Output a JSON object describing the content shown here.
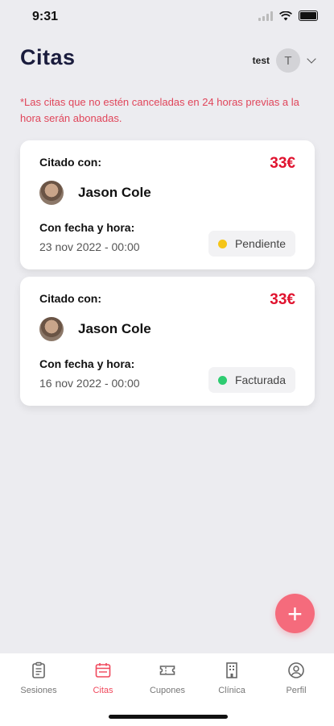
{
  "status": {
    "time": "9:31"
  },
  "header": {
    "title": "Citas",
    "username": "test",
    "avatar_initial": "T"
  },
  "notice": "*Las citas que no estén canceladas en 24 horas previas a la hora serán abonadas.",
  "colors": {
    "accent": "#f0485c",
    "price": "#e0132f",
    "pending": "#f5c518",
    "billed": "#2ecc71"
  },
  "appointments": [
    {
      "with_label": "Citado con:",
      "price": "33€",
      "name": "Jason Cole",
      "datetime_label": "Con fecha y hora:",
      "datetime": "23 nov 2022 - 00:00",
      "status": "Pendiente"
    },
    {
      "with_label": "Citado con:",
      "price": "33€",
      "name": "Jason Cole",
      "datetime_label": "Con fecha y hora:",
      "datetime": "16 nov 2022 - 00:00",
      "status": "Facturada"
    }
  ],
  "fab": {
    "label": "+"
  },
  "tabs": [
    {
      "label": "Sesiones",
      "icon": "clipboard-icon"
    },
    {
      "label": "Citas",
      "icon": "calendar-icon"
    },
    {
      "label": "Cupones",
      "icon": "ticket-icon"
    },
    {
      "label": "Clínica",
      "icon": "building-icon"
    },
    {
      "label": "Perfil",
      "icon": "user-circle-icon"
    }
  ]
}
